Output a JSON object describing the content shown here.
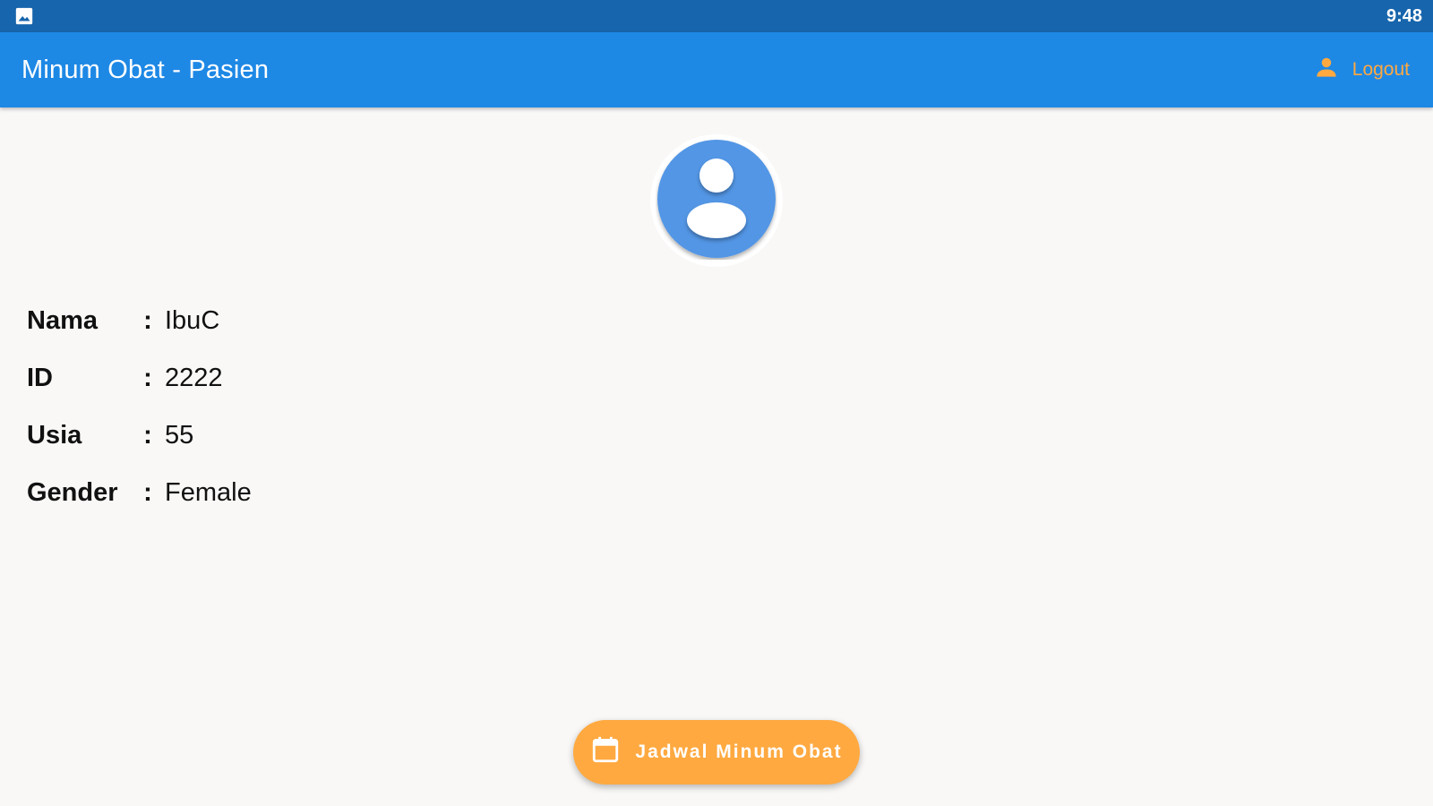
{
  "status_bar": {
    "time": "9:48",
    "notification_icon": "image-icon"
  },
  "app_bar": {
    "title": "Minum Obat - Pasien",
    "logout_label": "Logout",
    "logout_icon": "person-icon"
  },
  "profile": {
    "avatar_icon": "account-circle-icon",
    "fields": [
      {
        "label": "Nama",
        "colon": ":",
        "value": "IbuC"
      },
      {
        "label": "ID",
        "colon": ":",
        "value": "2222"
      },
      {
        "label": "Usia",
        "colon": ":",
        "value": "55"
      },
      {
        "label": "Gender",
        "colon": ":",
        "value": "Female"
      }
    ]
  },
  "fab": {
    "label": "Jadwal Minum Obat",
    "icon": "calendar-icon"
  },
  "colors": {
    "status_bar": "#1765ac",
    "app_bar": "#1e88e5",
    "accent": "#ffa940",
    "avatar": "#5296e5",
    "background": "#f9f8f7"
  }
}
